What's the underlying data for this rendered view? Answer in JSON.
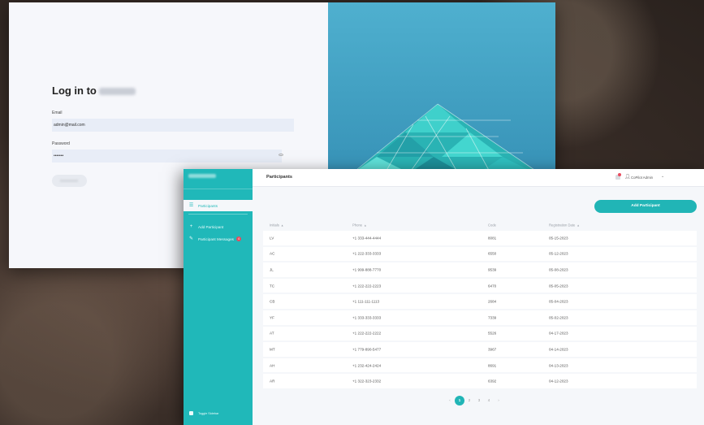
{
  "login": {
    "title": "Log in to",
    "email_label": "Email",
    "email_value": "admin@mail.com",
    "password_label": "Password",
    "password_value": "•••••••"
  },
  "sidebar": {
    "items": [
      {
        "label": "Participants",
        "icon": "list-icon"
      },
      {
        "label": "Add Participant",
        "icon": "plus-icon"
      },
      {
        "label": "Participant Messages",
        "icon": "chat-icon",
        "badge": "4"
      }
    ],
    "toggle_label": "Toggle Sidebar"
  },
  "header": {
    "title": "Participants",
    "user_name": "CoPilot Admin"
  },
  "actions": {
    "add_label": "Add Participant"
  },
  "table": {
    "columns": [
      "Initials",
      "Phone",
      "Code",
      "Registration Date"
    ],
    "rows": [
      [
        "LV",
        "+1 333-444-4444",
        "8081",
        "05-15-2023"
      ],
      [
        "AC",
        "+1 222-333-3333",
        "6550",
        "05-12-2023"
      ],
      [
        "JL",
        "+1 999-888-7770",
        "9539",
        "05-08-2023"
      ],
      [
        "TC",
        "+1 222-222-2223",
        "6470",
        "05-05-2023"
      ],
      [
        "CB",
        "+1 111-111-1113",
        "2684",
        "05-04-2023"
      ],
      [
        "YF",
        "+1 333-333-3333",
        "7339",
        "05-02-2023"
      ],
      [
        "AT",
        "+1 222-222-2222",
        "5526",
        "04-17-2023"
      ],
      [
        "MT",
        "+1 779-890-5477",
        "3967",
        "04-14-2023"
      ],
      [
        "AH",
        "+1 232-424-2424",
        "8691",
        "04-13-2023"
      ],
      [
        "AR",
        "+1 322-323-2332",
        "6392",
        "04-12-2023"
      ]
    ]
  },
  "pagination": {
    "prev": "‹",
    "pages": [
      "1",
      "2",
      "3",
      "4"
    ],
    "next": "›",
    "current": "1"
  },
  "colors": {
    "accent": "#21b5b6",
    "sidebar": "#20b8b9",
    "badge": "#e84b5e"
  }
}
